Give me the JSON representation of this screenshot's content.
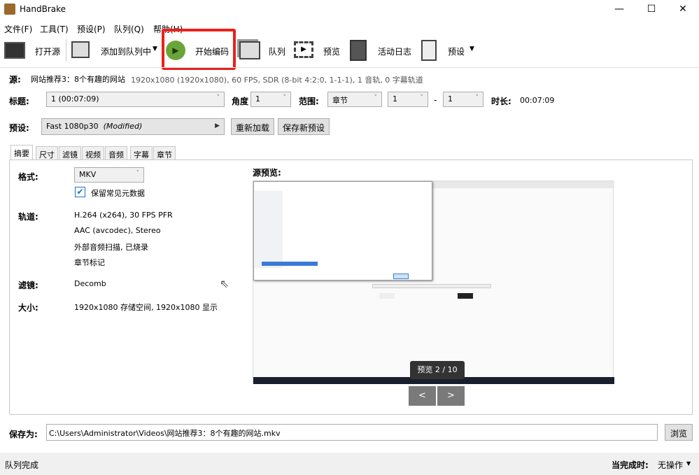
{
  "window": {
    "title": "HandBrake",
    "minimize": "—",
    "maximize": "☐",
    "close": "✕"
  },
  "menu": [
    "文件(F)",
    "工具(T)",
    "预设(P)",
    "队列(Q)",
    "帮助(H)"
  ],
  "toolbar": {
    "open_source": "打开源",
    "add_to_queue": "添加到队列中",
    "start_encode": "开始编码",
    "queue": "队列",
    "preview": "预览",
    "activity_log": "活动日志",
    "presets": "预设"
  },
  "source": {
    "label": "源:",
    "name": "网站推荐3：8个有趣的网站",
    "info": "1920x1080 (1920x1080), 60 FPS, SDR (8-bit 4:2:0, 1-1-1), 1 音轨, 0 字幕轨道"
  },
  "title_row": {
    "label": "标题:",
    "title_value": "1  (00:07:09)",
    "angle_label": "角度",
    "angle_value": "1",
    "range_label": "范围:",
    "range_type": "章节",
    "range_start": "1",
    "range_sep": "-",
    "range_end": "1",
    "duration_label": "时长:",
    "duration_value": "00:07:09"
  },
  "preset_row": {
    "label": "预设:",
    "preset_name": "Fast 1080p30",
    "preset_modified": "(Modified)",
    "reload": "重新加载",
    "save_new": "保存新预设"
  },
  "tabs": [
    "摘要",
    "尺寸",
    "滤镜",
    "视频",
    "音频",
    "字幕",
    "章节"
  ],
  "summary": {
    "format_label": "格式:",
    "format_value": "MKV",
    "keep_metadata": "保留常见元数据",
    "tracks_label": "轨道:",
    "tracks": [
      "H.264 (x264), 30 FPS PFR",
      "AAC (avcodec), Stereo",
      "外部音频扫描, 已烧录",
      "章节标记"
    ],
    "filters_label": "滤镜:",
    "filters_value": "Decomb",
    "size_label": "大小:",
    "size_value": "1920x1080 存储空间, 1920x1080 显示"
  },
  "preview": {
    "label": "源预览:",
    "tooltip": "预览 2 / 10",
    "prev": "<",
    "next": ">"
  },
  "save": {
    "label": "保存为:",
    "path": "C:\\Users\\Administrator\\Videos\\网站推荐3：8个有趣的网站.mkv",
    "browse": "浏览"
  },
  "statusbar": {
    "left": "队列完成",
    "when_done_label": "当完成时:",
    "when_done_value": "无操作"
  },
  "colors": {
    "highlight": "#e8221b",
    "play": "#6aa53a",
    "checkbox": "#1a73c9"
  }
}
